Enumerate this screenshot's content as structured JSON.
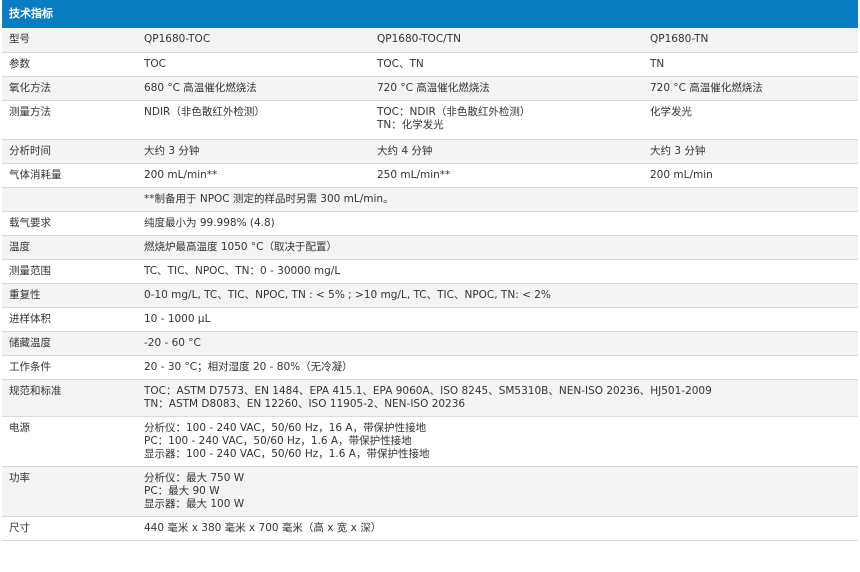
{
  "header": {
    "title": "技术指标"
  },
  "rows": [
    {
      "label": "型号",
      "cells": [
        "QP1680-TOC",
        "QP1680-TOC/TN",
        "QP1680-TN"
      ]
    },
    {
      "label": "参数",
      "cells": [
        "TOC",
        "TOC、TN",
        "TN"
      ]
    },
    {
      "label": "氧化方法",
      "cells": [
        "680 °C 高温催化燃烧法",
        "720 °C 高温催化燃烧法",
        "720 °C 高温催化燃烧法"
      ]
    },
    {
      "label": "测量方法",
      "cells": [
        "NDIR（非色散红外检测）",
        "TOC：NDIR（非色散红外检测）|TN：化学发光",
        "化学发光"
      ]
    },
    {
      "label": "分析时间",
      "cells": [
        "大约 3 分钟",
        "大约 4 分钟",
        "大约 3 分钟"
      ]
    },
    {
      "label": "气体消耗量",
      "cells": [
        "200 mL/min**",
        "250 mL/min**",
        "200 mL/min"
      ]
    },
    {
      "label": "",
      "span": "**制备用于 NPOC 测定的样品时另需 300 mL/min。"
    },
    {
      "label": "载气要求",
      "span": "纯度最小为 99.998% (4.8)"
    },
    {
      "label": "温度",
      "span": "燃烧炉最高温度 1050 °C（取决于配置）"
    },
    {
      "label": "测量范围",
      "span": "TC、TIC、NPOC、TN：0 - 30000 mg/L"
    },
    {
      "label": "重复性",
      "span": "0-10 mg/L, TC、TIC、NPOC, TN : < 5% ; >10 mg/L, TC、TIC、NPOC, TN: < 2%"
    },
    {
      "label": "进样体积",
      "span": "10 - 1000 µL"
    },
    {
      "label": "储藏温度",
      "span": "-20 - 60 °C"
    },
    {
      "label": "工作条件",
      "span": "20 - 30 °C；相对湿度 20 - 80%（无冷凝）"
    },
    {
      "label": "规范和标准",
      "span": "TOC：ASTM D7573、EN 1484、EPA 415.1、EPA 9060A、ISO 8245、SM5310B、NEN-ISO 20236、HJ501-2009|TN：ASTM D8083、EN 12260、ISO 11905-2、NEN-ISO 20236"
    },
    {
      "label": "电源",
      "span": "分析仪：100 - 240 VAC，50/60 Hz，16 A，带保护性接地|PC：100 - 240 VAC，50/60 Hz，1.6 A，带保护性接地|显示器：100 - 240 VAC，50/60 Hz，1.6 A，带保护性接地"
    },
    {
      "label": "功率",
      "span": "分析仪：最大 750 W|PC：最大 90 W|显示器：最大 100 W"
    },
    {
      "label": "尺寸",
      "span": "440 毫米 x 380 毫米 x 700 毫米（高 x 宽 x 深）"
    }
  ]
}
